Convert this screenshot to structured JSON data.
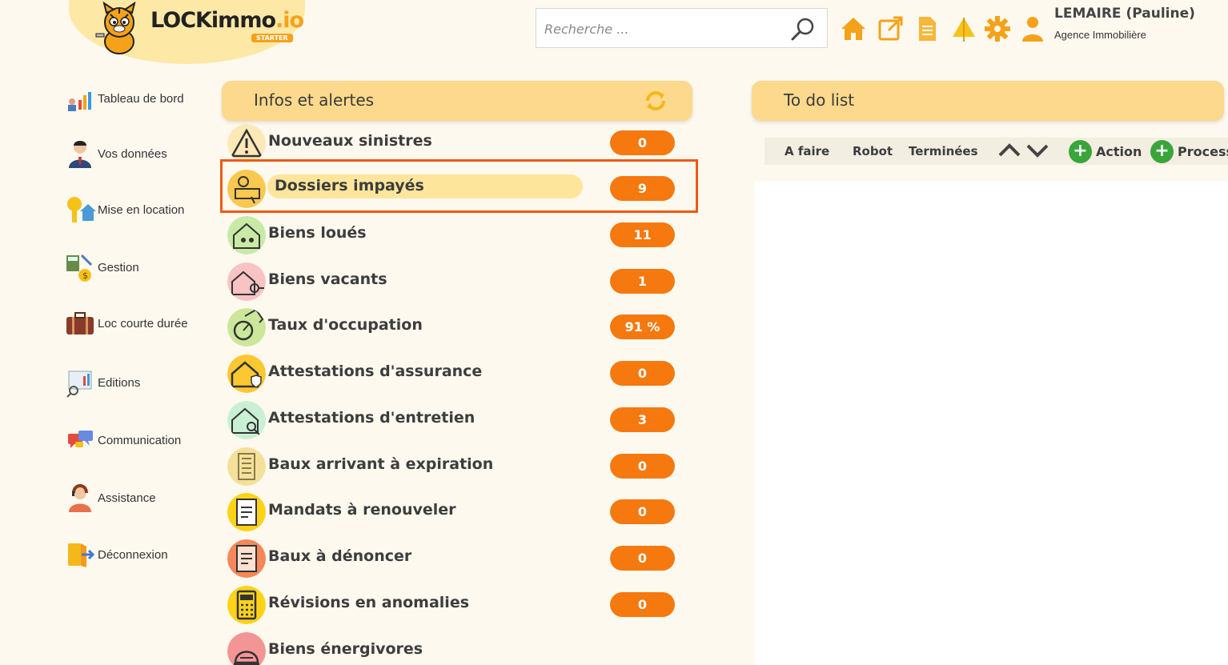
{
  "brand": {
    "name_main": "LOCKimmo",
    "name_suffix": ".io",
    "plan": "STARTER"
  },
  "search": {
    "placeholder": "Recherche ..."
  },
  "user": {
    "name": "LEMAIRE (Pauline)",
    "role": "Agence Immobilière"
  },
  "toolbar": {
    "icons": [
      "home-icon",
      "external-link-icon",
      "document-icon",
      "tree-icon",
      "gear-icon",
      "user-icon"
    ],
    "accent": "#f5a21a"
  },
  "sidebar": {
    "items": [
      {
        "label": "Tableau de bord",
        "icon": "dashboard-chart-icon"
      },
      {
        "label": "Vos données",
        "icon": "person-icon"
      },
      {
        "label": "Mise en location",
        "icon": "key-house-icon"
      },
      {
        "label": "Gestion",
        "icon": "calculator-icon"
      },
      {
        "label": "Loc courte durée",
        "icon": "suitcase-icon"
      },
      {
        "label": "Editions",
        "icon": "report-icon"
      },
      {
        "label": "Communication",
        "icon": "chat-bubbles-icon"
      },
      {
        "label": "Assistance",
        "icon": "support-agent-icon"
      },
      {
        "label": "Déconnexion",
        "icon": "logout-icon"
      }
    ]
  },
  "infos": {
    "title": "Infos et alertes",
    "rows": [
      {
        "label": "Nouveaux sinistres",
        "count": "0",
        "icon": "warning-icon",
        "bg": "#fde8b8"
      },
      {
        "label": "Dossiers impayés",
        "count": "9",
        "icon": "unpaid-money-icon",
        "bg": "#f9c84f",
        "highlighted": true
      },
      {
        "label": "Biens loués",
        "count": "11",
        "icon": "rented-house-icon",
        "bg": "#c8eaa6"
      },
      {
        "label": "Biens vacants",
        "count": "1",
        "icon": "vacant-house-key-icon",
        "bg": "#f8c3c3"
      },
      {
        "label": "Taux d'occupation",
        "count": "91 %",
        "icon": "occupancy-rate-icon",
        "bg": "#cbe79a"
      },
      {
        "label": "Attestations d'assurance",
        "count": "0",
        "icon": "insurance-house-icon",
        "bg": "#fcc832"
      },
      {
        "label": "Attestations d'entretien",
        "count": "3",
        "icon": "maintenance-house-icon",
        "bg": "#c9f0d5"
      },
      {
        "label": "Baux arrivant à expiration",
        "count": "0",
        "icon": "building-icon",
        "bg": "#f4e09a"
      },
      {
        "label": "Mandats à renouveler",
        "count": "0",
        "icon": "mandate-document-icon",
        "bg": "#fcd317"
      },
      {
        "label": "Baux à dénoncer",
        "count": "0",
        "icon": "lease-document-icon",
        "bg": "#f5875a"
      },
      {
        "label": "Révisions en anomalies",
        "count": "0",
        "icon": "calculator-icon",
        "bg": "#fcd317"
      },
      {
        "label": "Biens énergivores",
        "count": "",
        "icon": "energy-bell-icon",
        "bg": "#f49595"
      }
    ]
  },
  "todo": {
    "title": "To do list",
    "tabs": [
      "A faire",
      "Robot",
      "Terminées"
    ],
    "actions": [
      {
        "label": "Action"
      },
      {
        "label": "Process"
      }
    ]
  }
}
